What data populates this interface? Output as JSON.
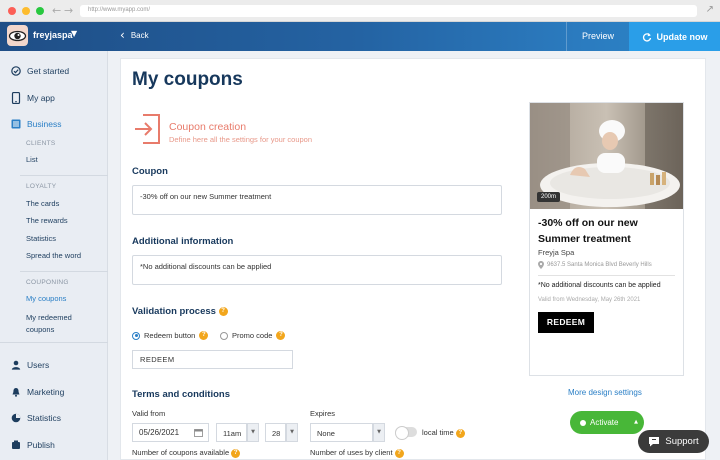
{
  "browser": {
    "url": "http://www.myapp.com/"
  },
  "header": {
    "brand": "freyjaspa",
    "back_label": "Back",
    "preview_label": "Preview",
    "update_label": "Update now"
  },
  "sidebar": {
    "get_started": "Get started",
    "my_app": "My app",
    "business": "Business",
    "clients_head": "CLIENTS",
    "list": "List",
    "loyalty_head": "LOYALTY",
    "the_cards": "The cards",
    "the_rewards": "The rewards",
    "statistics_sub": "Statistics",
    "spread": "Spread the word",
    "couponing_head": "COUPONING",
    "my_coupons": "My coupons",
    "my_redeemed": "My redeemed coupons",
    "users": "Users",
    "marketing": "Marketing",
    "statistics": "Statistics",
    "publish": "Publish"
  },
  "main": {
    "title": "My coupons",
    "creation_title": "Coupon creation",
    "creation_sub": "Define here all the settings for your coupon",
    "coupon_label": "Coupon",
    "coupon_value": "-30% off on our new Summer treatment",
    "info_label": "Additional information",
    "info_value": "*No additional discounts can be applied",
    "validation_label": "Validation process",
    "redeem_option": "Redeem button",
    "promo_option": "Promo code",
    "redeem_value": "REDEEM",
    "terms_label": "Terms and conditions",
    "valid_from": "Valid from",
    "date": "05/26/2021",
    "hour": "11am",
    "minute": "28",
    "expires": "Expires",
    "expires_value": "None",
    "local_time": "local time",
    "num_coupons": "Number of coupons available",
    "num_uses": "Number of uses by client"
  },
  "preview": {
    "distance": "200m",
    "title": "-30% off on our new Summer treatment",
    "name": "Freyja Spa",
    "address": "9637.5 Santa Monica Blvd Beverly Hills",
    "info": "*No additional discounts can be applied",
    "valid": "Valid from Wednesday, May 26th 2021",
    "redeem": "REDEEM"
  },
  "actions": {
    "more_design": "More design settings",
    "activate": "Activate",
    "support": "Support"
  },
  "colors": {
    "accent": "#2a7fc6",
    "coral": "#e87b6b",
    "green": "#48b738",
    "navy": "#17385c"
  }
}
